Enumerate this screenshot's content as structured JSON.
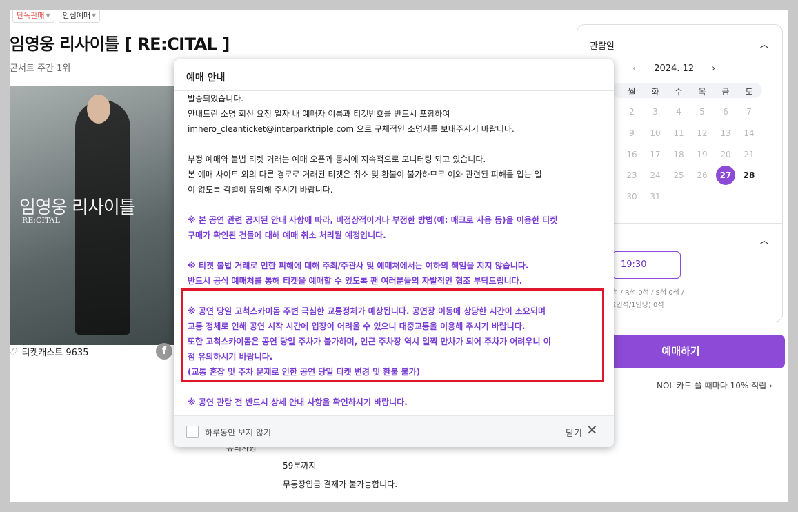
{
  "badges": [
    "단독판매",
    "안심예매"
  ],
  "title": "임영웅 리사이틀  [ RE:CITAL ]",
  "rank": "콘서트 주간 1위",
  "poster": {
    "title": "임영웅 리사이틀",
    "subtitle": "RE:CITAL"
  },
  "ticketcast": "티켓캐스트 9635",
  "background_info": {
    "label": "유의사항",
    "line1": "59분까지",
    "line2": "무통장입금 결제가 불가능합니다."
  },
  "calendar": {
    "heading": "관람일",
    "month": "2024. 12",
    "weekdays": [
      "월",
      "화",
      "수",
      "목",
      "금",
      "토"
    ],
    "weeks": [
      [
        "2",
        "3",
        "4",
        "5",
        "6",
        "7"
      ],
      [
        "9",
        "10",
        "11",
        "12",
        "13",
        "14"
      ],
      [
        "16",
        "17",
        "18",
        "19",
        "20",
        "21"
      ],
      [
        "23",
        "24",
        "25",
        "26",
        "27",
        "28"
      ],
      [
        "30",
        "31"
      ]
    ],
    "selected": "27",
    "available": [
      "28"
    ]
  },
  "time": {
    "value": "19:30"
  },
  "seats": {
    "line1": "석 / R석 0석 / S석 0석 /",
    "line2": "2인석/1인당) 0석"
  },
  "book_button": "예매하기",
  "nol": "NOL 카드 쓸 때마다 10% 적립 ›",
  "modal": {
    "title": "예매 안내",
    "lines": [
      {
        "t": "발송되었습니다.",
        "c": "n"
      },
      {
        "t": "안내드린 소명 회신 요청 일자 내 예매자 이름과 티켓번호를 반드시 포함하여",
        "c": "n"
      },
      {
        "t": "imhero_cleanticket@interparktriple.com 으로 구체적인 소명서를 보내주시기 바랍니다.",
        "c": "n"
      },
      {
        "t": "",
        "c": "gap"
      },
      {
        "t": "부정 예매와 불법 티켓 거래는 예매 오픈과 동시에 지속적으로 모니터링 되고 있습니다.",
        "c": "n"
      },
      {
        "t": "본 예매 사이트 외의 다른 경로로 거래된 티켓은 취소 및 환불이 불가하므로 이와 관련된 피해를 입는 일",
        "c": "n"
      },
      {
        "t": "이 없도록 각별히 유의해 주시기 바랍니다.",
        "c": "n"
      },
      {
        "t": "",
        "c": "gap"
      },
      {
        "t": "※ 본 공연 관련 공지된 안내 사항에 따라, 비정상적이거나 부정한 방법(예: 매크로 사용 등)을 이용한 티켓",
        "c": "p"
      },
      {
        "t": "구매가 확인된 건들에 대해 예매 취소 처리될 예정입니다.",
        "c": "p"
      },
      {
        "t": "",
        "c": "gap"
      },
      {
        "t": "※ 티켓 불법 거래로 인한 피해에 대해 주최/주관사 및 예매처에서는 여하의 책임을 지지 않습니다.",
        "c": "p"
      },
      {
        "t": "반드시 공식 예매처를 통해 티켓을 예매할 수 있도록 팬 여러분들의 자발적인 협조 부탁드립니다.",
        "c": "p"
      },
      {
        "t": "",
        "c": "gap"
      },
      {
        "t": "※ 공연 당일 고척스카이돔 주변 극심한 교통정체가 예상됩니다. 공연장 이동에 상당한 시간이 소요되며",
        "c": "p"
      },
      {
        "t": "교통 정체로 인해 공연 시작 시간에 입장이 어려울 수 있으니 대중교통을 이용해 주시기 바랍니다.",
        "c": "p"
      },
      {
        "t": "또한 고척스카이돔은 공연 당일 주차가 불가하며, 인근 주차장 역시 일찍 만차가 되어 주차가 어려우니 이",
        "c": "p"
      },
      {
        "t": "점 유의하시기 바랍니다.",
        "c": "p"
      },
      {
        "t": "(교통 혼잡 및 주차 문제로 인한 공연 당일 티켓 변경 및 환불 불가)",
        "c": "p"
      },
      {
        "t": "",
        "c": "gap"
      },
      {
        "t": "※ 공연 관람 전 반드시 상세 안내 사항을 확인하시기 바랍니다.",
        "c": "p"
      }
    ],
    "dont_show": "하루동안 보지 않기",
    "close": "닫기"
  },
  "colors": {
    "accent": "#8d4ad6",
    "highlight": "#e0172a",
    "notice": "#7a3fd2"
  }
}
